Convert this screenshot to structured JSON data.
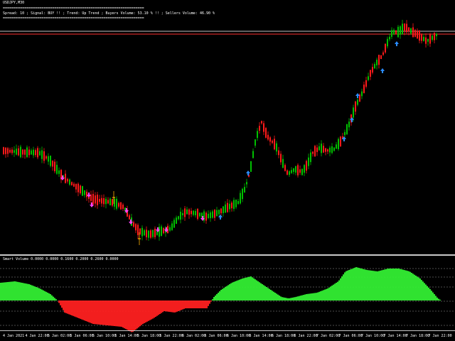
{
  "window": {
    "title": "USDJPY,M30"
  },
  "info_panel": {
    "separator": "==================================================================",
    "line": "Spread: 10 ;   Signal: BUY !! ;   Trend: Up Trend ;   Buyers Volume: 53.10 % !! ;   Sellers Volume: 46.90 %",
    "separator2": "=================================================================="
  },
  "indicator": {
    "title": "Smart Volume 0.0000 0.0000 0.1600 0.2000 0.2600 0.0000"
  },
  "time_axis": {
    "labels": [
      "4 Jan 2021",
      "4 Jan 22:00",
      "5 Jan 02:00",
      "5 Jan 06:00",
      "5 Jan 10:00",
      "5 Jan 14:00",
      "5 Jan 18:00",
      "5 Jan 22:00",
      "6 Jan 02:00",
      "6 Jan 06:00",
      "6 Jan 10:00",
      "6 Jan 14:00",
      "6 Jan 18:00",
      "6 Jan 22:00",
      "7 Jan 02:00",
      "7 Jan 06:00",
      "7 Jan 10:00",
      "7 Jan 14:00",
      "7 Jan 18:00",
      "7 Jan 22:00"
    ]
  },
  "colors": {
    "background": "#000000",
    "bull_candle": "#00c000",
    "bear_candle": "#ff1a1a",
    "doji_candle": "#ffb000",
    "buy_arrow": "#2a8cff",
    "sell_arrow": "#ff40ff",
    "price_line": "#ff3030",
    "level_line": "#ffffff",
    "histogram_up": "#33ee33",
    "histogram_down": "#ff2020",
    "divider": "#c8c8c8"
  }
}
